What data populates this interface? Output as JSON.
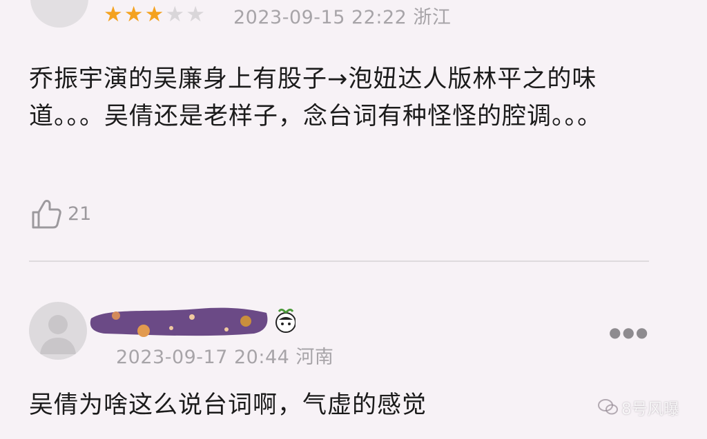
{
  "comments": [
    {
      "rating": 3,
      "rating_max": 5,
      "date": "2023-09-15 22:22",
      "location": "浙江",
      "text": "乔振宇演的吴廉身上有股子→泡妞达人版林平之的味道。。。吴倩还是老样子，念台词有种怪怪的腔调。。。",
      "likes": "21",
      "icons": [
        "avatar-placeholder-icon",
        "star-icon",
        "thumbs-up-icon"
      ]
    },
    {
      "date": "2023-09-17 20:44",
      "location": "河南",
      "text": "吴倩为啥这么说台词啊，气虚的感觉",
      "icons": [
        "avatar-placeholder-icon",
        "more-dots-icon"
      ]
    }
  ],
  "watermark": {
    "text": "8号风曝",
    "icon": "wechat-icon"
  },
  "colors": {
    "background": "#f7f2f6",
    "star_active": "#f4a21f",
    "star_inactive": "#d9d6d9",
    "meta_text": "#a7a4a8",
    "username_redacted": "#6b4a86"
  }
}
